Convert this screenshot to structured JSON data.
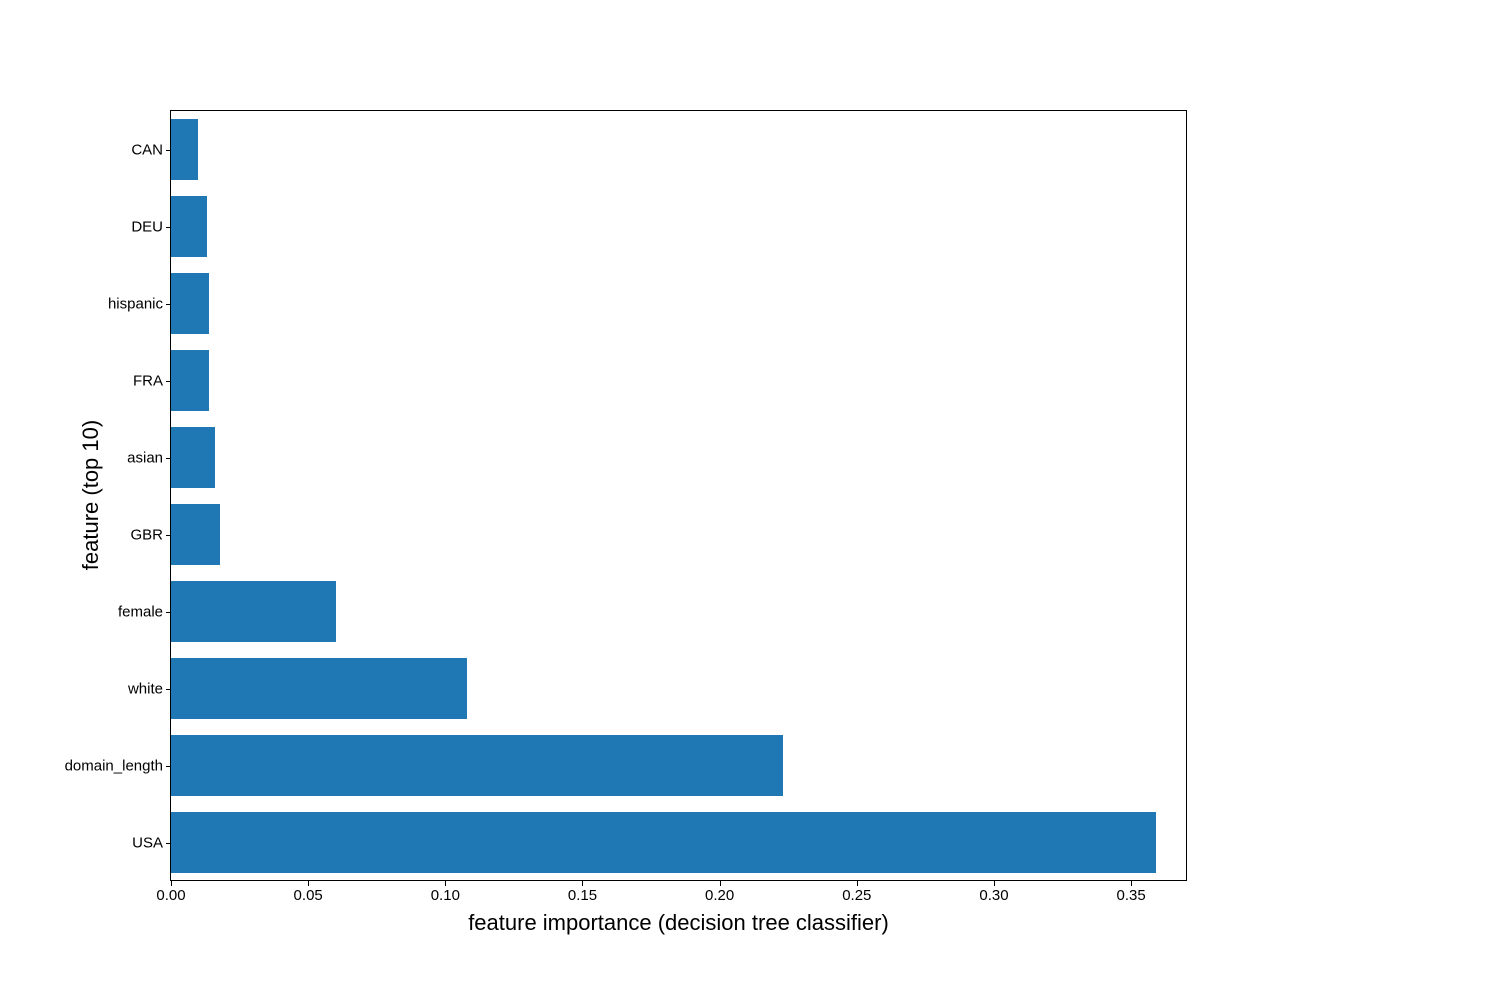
{
  "chart_data": {
    "type": "bar",
    "orientation": "horizontal",
    "categories": [
      "CAN",
      "DEU",
      "hispanic",
      "FRA",
      "asian",
      "GBR",
      "female",
      "white",
      "domain_length",
      "USA"
    ],
    "values": [
      0.01,
      0.013,
      0.014,
      0.014,
      0.016,
      0.018,
      0.06,
      0.108,
      0.223,
      0.359
    ],
    "xlabel": "feature importance (decision tree classifier)",
    "ylabel": "feature (top 10)",
    "xlim": [
      0,
      0.37
    ],
    "x_ticks": [
      0.0,
      0.05,
      0.1,
      0.15,
      0.2,
      0.25,
      0.3,
      0.35
    ],
    "x_tick_labels": [
      "0.00",
      "0.05",
      "0.10",
      "0.15",
      "0.20",
      "0.25",
      "0.30",
      "0.35"
    ],
    "bar_color": "#1f77b4"
  }
}
